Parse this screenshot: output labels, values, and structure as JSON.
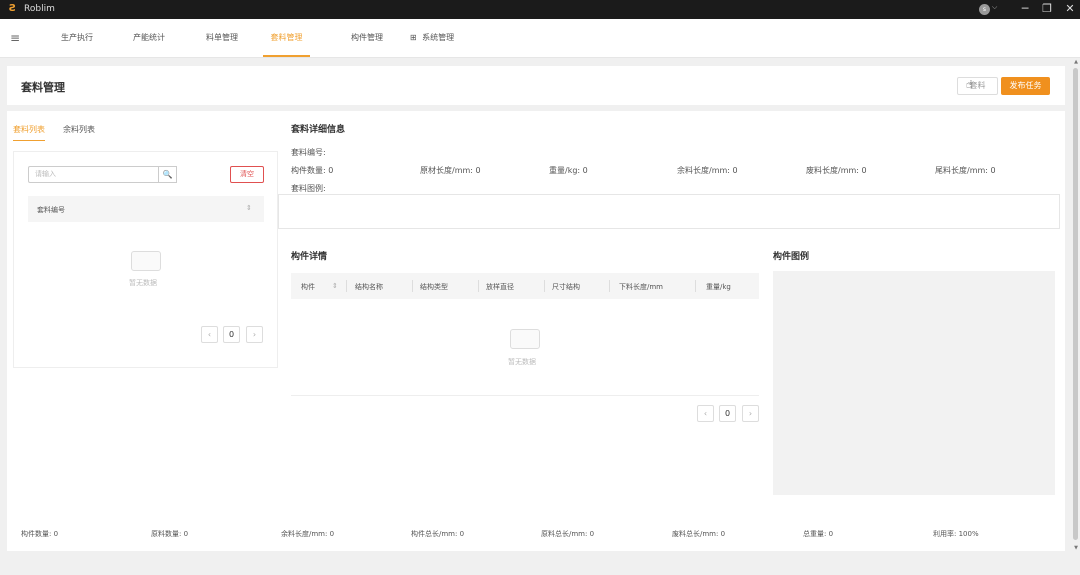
{
  "titlebar": {
    "logo": "Ƨ",
    "app_name": "Roblim",
    "user_initial": "s",
    "user_caret": "⌵",
    "minimize": "─",
    "restore": "❐",
    "close": "✕"
  },
  "nav": {
    "menu_icon": "≡",
    "items": [
      {
        "label": "生产执行"
      },
      {
        "label": "产能统计"
      },
      {
        "label": "料单管理"
      },
      {
        "label": "套料管理"
      },
      {
        "label": "构件管理"
      },
      {
        "label": "系统管理",
        "icon": "⊞"
      }
    ],
    "active_index": 3
  },
  "header": {
    "title": "套料管理",
    "outline_button": "套料",
    "primary_button": "发布任务"
  },
  "left": {
    "tabs": [
      "套料列表",
      "余料列表"
    ],
    "search_placeholder": "请输入",
    "search_icon": "🔍",
    "clear_button": "清空",
    "column_header": "套料编号",
    "sort_icon": "⇕",
    "empty_text": "暂无数据",
    "pager": {
      "prev": "‹",
      "page": "0",
      "next": "›"
    }
  },
  "detail": {
    "title": "套料详细信息",
    "nesting_no_label": "套料编号:",
    "fields": [
      "构件数量: 0",
      "原材长度/mm: 0",
      "重量/kg: 0",
      "余料长度/mm: 0",
      "废料长度/mm: 0",
      "尾料长度/mm: 0"
    ],
    "pattern_label": "套料图例:"
  },
  "parts": {
    "title": "构件详情",
    "columns": [
      "构件",
      "结构名称",
      "结构类型",
      "放样直径",
      "尺寸结构",
      "下料长度/mm",
      "重量/kg"
    ],
    "sort_icon": "⇕",
    "empty_text": "暂无数据",
    "pager": {
      "prev": "‹",
      "page": "0",
      "next": "›"
    }
  },
  "legend": {
    "title": "构件图例"
  },
  "footer": {
    "stats": [
      "构件数量: 0",
      "原料数量: 0",
      "余料长度/mm: 0",
      "构件总长/mm: 0",
      "原料总长/mm: 0",
      "废料总长/mm: 0",
      "总重量: 0",
      "利用率: 100%"
    ]
  },
  "scrollbar": {
    "up": "▲",
    "down": "▼"
  },
  "colors": {
    "accent": "#f0a030",
    "primary_button": "#f0901e",
    "danger": "#e05050",
    "titlebar": "#1b1b1b"
  }
}
